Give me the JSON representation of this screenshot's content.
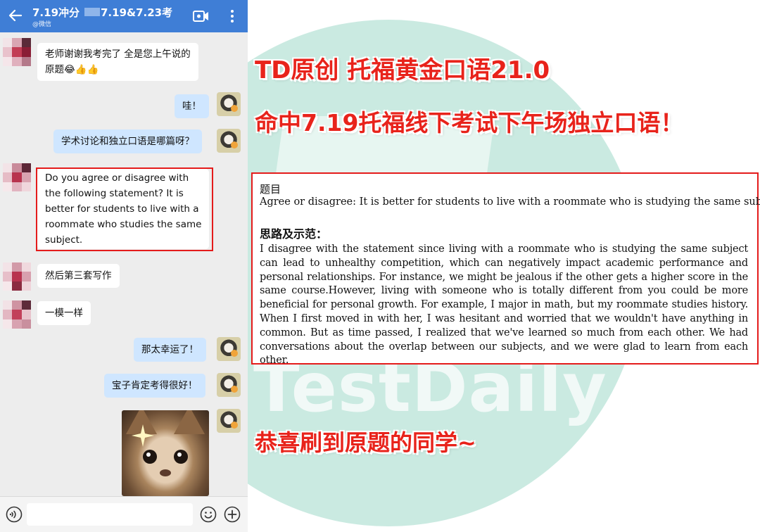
{
  "colors": {
    "header_blue": "#3f7ed6",
    "headline_red": "#e8231b",
    "self_bubble": "#cfe6ff",
    "watermark_teal": "#9fd9c9"
  },
  "watermark": {
    "text": "TestDaily"
  },
  "chat": {
    "header": {
      "title": "7.19冲分",
      "subtitle": "@微信",
      "group": "7.19&7.23考",
      "icons": {
        "back": "back-arrow-icon",
        "video": "video-call-icon",
        "more": "more-vertical-icon"
      }
    },
    "messages": [
      {
        "side": "left",
        "text_lines": [
          "老师谢谢我考完了 全是您上午说的",
          "原题😂👍👍"
        ]
      },
      {
        "side": "right",
        "text": "哇！"
      },
      {
        "side": "right",
        "text": "学术讨论和独立口语是哪篇呀？"
      },
      {
        "side": "left",
        "text_lines": [
          "Do you agree or disagree with",
          "the following statement? It is",
          "better for students to live with a",
          "roommate who studies the same",
          "subject."
        ]
      },
      {
        "side": "left",
        "text": "然后第三套写作"
      },
      {
        "side": "left",
        "text": "一模一样"
      },
      {
        "side": "right",
        "text": "那太幸运了！"
      },
      {
        "side": "right",
        "text": "宝子肯定考得很好！"
      },
      {
        "side": "right",
        "image": "cat-sticker"
      }
    ],
    "input": {
      "placeholder": "",
      "icons": {
        "voice": "voice-icon",
        "emoji": "emoji-icon",
        "plus": "plus-icon"
      }
    }
  },
  "headline": {
    "line1": "TD原创 托福黄金口语21.0",
    "line2": "命中7.19托福线下考试下午场独立口语！",
    "footer": "恭喜刷到原题的同学~"
  },
  "document": {
    "question_label": "题目",
    "question": "Agree or disagree: It is better for students to live with a roommate who is studying the same subject.",
    "answer_label": "思路及示范：",
    "answer": "I disagree with the statement since living with a roommate who is studying the same subject can lead to unhealthy competition, which can negatively impact academic performance and personal relationships. For instance, we might be jealous if the other gets a higher score in the same course.However, living with someone who is totally different from you could be more beneficial for personal growth. For example, I major in math, but my roommate studies history. When I first moved in with her, I was hesitant and worried that we wouldn't have anything in common. But as time passed, I realized that we've learned so much from each other. We had conversations about the overlap between our subjects, and we were glad to learn from each other."
  }
}
